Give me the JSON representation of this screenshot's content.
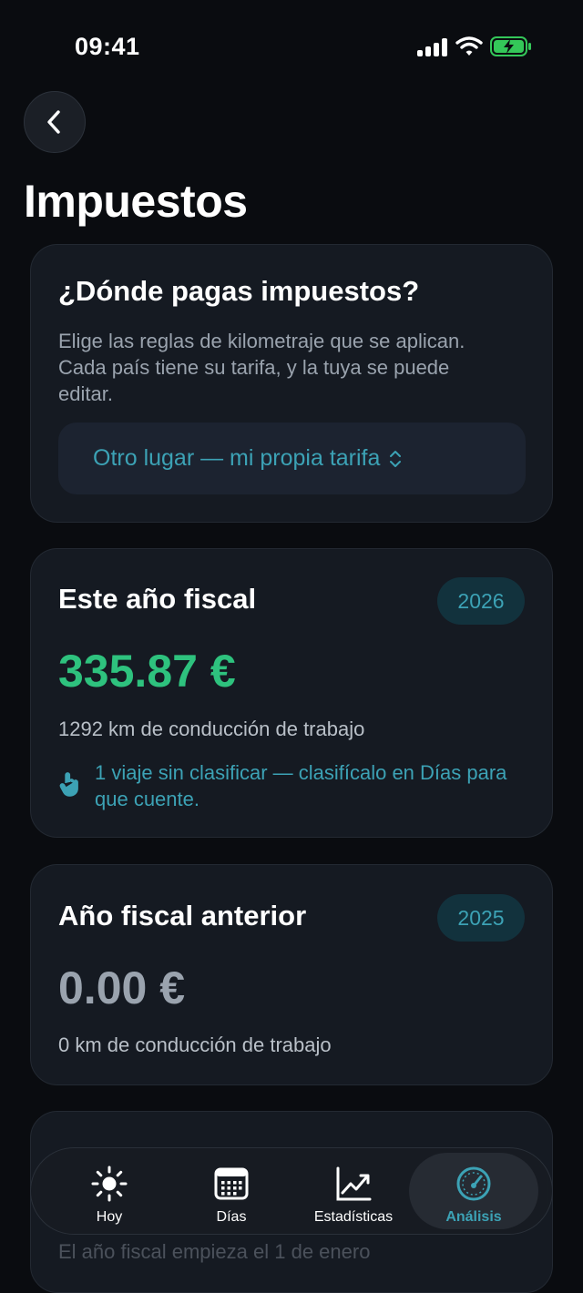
{
  "status_bar": {
    "time": "09:41"
  },
  "page": {
    "title": "Impuestos"
  },
  "tax_region": {
    "title": "¿Dónde pagas impuestos?",
    "description": "Elige las reglas de kilometraje que se aplican. Cada país tiene su tarifa, y la tuya se puede editar.",
    "selected": "Otro lugar — mi propia tarifa"
  },
  "current_year": {
    "title": "Este año fiscal",
    "year": "2026",
    "amount": "335.87 €",
    "km": "1292 km de conducción de trabajo",
    "hint": "1 viaje sin clasificar — clasifícalo en Días para que cuente."
  },
  "previous_year": {
    "title": "Año fiscal anterior",
    "year": "2025",
    "amount": "0.00 €",
    "km": "0 km de conducción de trabajo"
  },
  "partial_card": {
    "note": "El año fiscal empieza el 1 de enero"
  },
  "tab_bar": {
    "tabs": [
      {
        "label": "Hoy",
        "icon": "sun-icon"
      },
      {
        "label": "Días",
        "icon": "calendar-icon"
      },
      {
        "label": "Estadísticas",
        "icon": "chart-icon"
      },
      {
        "label": "Análisis",
        "icon": "gauge-icon"
      }
    ],
    "active_tab": "Análisis"
  },
  "colors": {
    "accent": "#3ca2b5",
    "positive": "#2ec27e",
    "battery": "#34c759",
    "background": "#0a0c10",
    "card": "#151a22"
  }
}
